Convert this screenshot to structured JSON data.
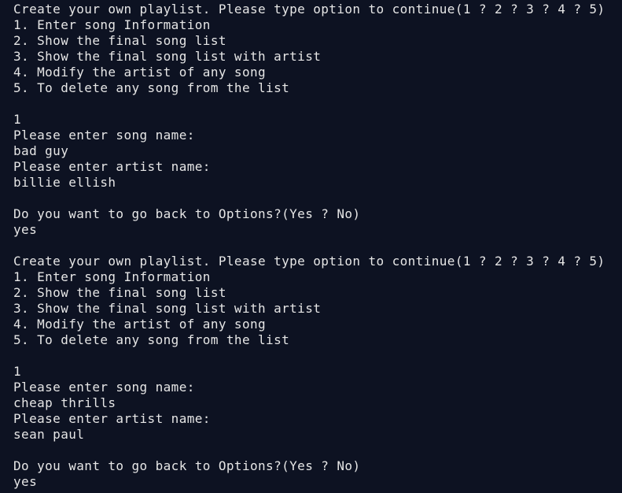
{
  "terminal": {
    "lines": [
      "Create your own playlist. Please type option to continue(1 ? 2 ? 3 ? 4 ? 5)",
      "1. Enter song Information",
      "2. Show the final song list",
      "3. Show the final song list with artist",
      "4. Modify the artist of any song",
      "5. To delete any song from the list",
      "",
      "1",
      "Please enter song name:",
      "bad guy",
      "Please enter artist name:",
      "billie ellish",
      "",
      "Do you want to go back to Options?(Yes ? No)",
      "yes",
      "",
      "Create your own playlist. Please type option to continue(1 ? 2 ? 3 ? 4 ? 5)",
      "1. Enter song Information",
      "2. Show the final song list",
      "3. Show the final song list with artist",
      "4. Modify the artist of any song",
      "5. To delete any song from the list",
      "",
      "1",
      "Please enter song name:",
      "cheap thrills",
      "Please enter artist name:",
      "sean paul",
      "",
      "Do you want to go back to Options?(Yes ? No)",
      "yes"
    ]
  }
}
